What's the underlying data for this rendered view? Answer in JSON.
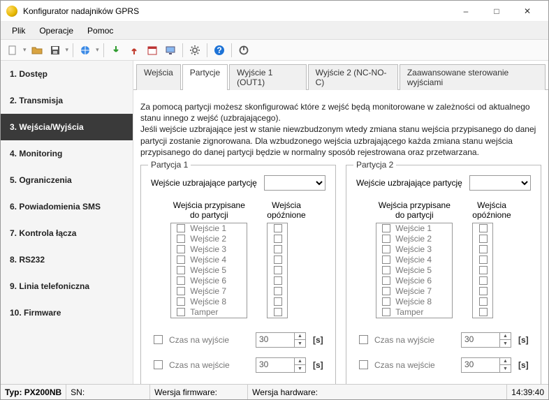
{
  "window": {
    "title": "Konfigurator nadajników GPRS"
  },
  "menu": {
    "file": "Plik",
    "operations": "Operacje",
    "help": "Pomoc"
  },
  "sidebar": {
    "items": [
      {
        "label": "1. Dostęp"
      },
      {
        "label": "2. Transmisja"
      },
      {
        "label": "3. Wejścia/Wyjścia",
        "active": true
      },
      {
        "label": "4. Monitoring"
      },
      {
        "label": "5. Ograniczenia"
      },
      {
        "label": "6. Powiadomienia SMS"
      },
      {
        "label": "7. Kontrola łącza"
      },
      {
        "label": "8. RS232"
      },
      {
        "label": "9. Linia telefoniczna"
      },
      {
        "label": "10. Firmware"
      }
    ]
  },
  "tabs": {
    "inputs": "Wejścia",
    "partitions": "Partycje",
    "out1": "Wyjście 1 (OUT1)",
    "out2": "Wyjście 2 (NC-NO-C)",
    "advanced": "Zaawansowane sterowanie wyjściami"
  },
  "description": "Za pomocą partycji możesz skonfigurować które z wejść będą monitorowane w zależności od aktualnego stanu innego z wejść (uzbrajającego).\nJeśli wejście uzbrajające jest w stanie niewzbudzonym wtedy zmiana stanu wejścia przypisanego do danej partycji zostanie zignorowana. Dla wzbudzonego wejścia uzbrajającego każda zmiana stanu wejścia przypisanego do danej partycji będzie w normalny sposób rejestrowana oraz przetwarzana.",
  "partition_labels": {
    "legend1": "Partycja 1",
    "legend2": "Partycja 2",
    "arm_input": "Wejście uzbrajające partycję",
    "assigned": "Wejścia przypisane\ndo partycji",
    "delayed": "Wejścia\nopóźnione",
    "exit_delay": "Czas na wyjście",
    "entry_delay": "Czas na wejście",
    "unit": "[s]"
  },
  "inputs_list": [
    "Wejście 1",
    "Wejście 2",
    "Wejście 3",
    "Wejście 4",
    "Wejście 5",
    "Wejście 6",
    "Wejście 7",
    "Wejście 8",
    "Tamper"
  ],
  "values": {
    "p1": {
      "exit": "30",
      "entry": "30"
    },
    "p2": {
      "exit": "30",
      "entry": "30"
    }
  },
  "status": {
    "type_label": "Typ:",
    "type_value": "PX200NB",
    "sn_label": "SN:",
    "fw_label": "Wersja firmware:",
    "hw_label": "Wersja hardware:",
    "time": "14:39:40"
  }
}
